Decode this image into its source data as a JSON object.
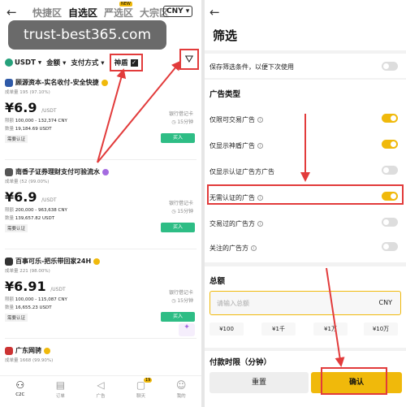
{
  "left": {
    "back_icon": "arrow-left-icon",
    "tabs": [
      {
        "label": "快捷区"
      },
      {
        "label": "自选区"
      },
      {
        "label": "严选区"
      },
      {
        "label": "大宗区"
      }
    ],
    "tab_badge": "NEW",
    "currency_select": "CNY ▾",
    "watermark": "trust-best365.com",
    "filters": {
      "coin": "USDT ▾",
      "amount": "金额 ▾",
      "payment": "支付方式 ▾",
      "shendun": "神盾"
    },
    "ads": [
      {
        "name": "顾源资本-实名收付-安全快捷",
        "stats": "成单量 195 (97.10%)",
        "price": "¥6.9",
        "unit": "/USDT",
        "limit_label": "限额",
        "limit": "100,000 - 132,374 CNY",
        "qty_label": "数量",
        "qty": "19,184.69 USDT",
        "pay": "银行借记卡",
        "time": "15分钟",
        "buy": "买入",
        "auth": "需要认证"
      },
      {
        "name": "南香子证券理财支付可验流水",
        "stats": "成单量 (52 (99.00%)",
        "price": "¥6.9",
        "unit": "/USDT",
        "limit_label": "限额",
        "limit": "200,000 - 963,638 CNY",
        "qty_label": "数量",
        "qty": "139,657.82 USDT",
        "pay": "银行借记卡",
        "time": "15分钟",
        "buy": "买入",
        "auth": "需要认证"
      },
      {
        "name": "百事可乐-把乐带回家24H",
        "stats": "成单量 221 (98.00%)",
        "price": "¥6.91",
        "unit": "/USDT",
        "limit_label": "限额",
        "limit": "100,000 - 115,087 CNY",
        "qty_label": "数量",
        "qty": "16,655.23 USDT",
        "pay": "银行借记卡",
        "time": "15分钟",
        "buy": "买入",
        "auth": "需要认证"
      },
      {
        "name": "广东网骋",
        "stats": "成单量 1668 (99.90%)",
        "price": "",
        "unit": "",
        "limit_label": "",
        "limit": "",
        "qty_label": "",
        "qty": "",
        "pay": "",
        "time": "",
        "buy": "",
        "auth": ""
      }
    ],
    "nav": [
      {
        "label": "C2C",
        "icon": "people-icon"
      },
      {
        "label": "订单",
        "icon": "orders-icon"
      },
      {
        "label": "广告",
        "icon": "megaphone-icon"
      },
      {
        "label": "聊天",
        "icon": "chat-icon"
      },
      {
        "label": "我的",
        "icon": "user-icon"
      }
    ],
    "chat_badge": "19"
  },
  "right": {
    "back_icon": "arrow-left-icon",
    "title": "筛选",
    "save_filter": "保存筛选条件，以便下次使用",
    "ad_type_heading": "广告类型",
    "options": [
      {
        "label": "仅限可交易广告",
        "on": true
      },
      {
        "label": "仅显示神盾广告",
        "on": true
      },
      {
        "label": "仅显示认证广告方广告",
        "on": false
      },
      {
        "label": "无需认证的广告",
        "on": true
      },
      {
        "label": "交易过的广告方",
        "on": false
      },
      {
        "label": "关注的广告方",
        "on": false
      }
    ],
    "amount_heading": "总额",
    "amount_placeholder": "请输入总额",
    "amount_currency": "CNY",
    "quick_amounts": [
      "¥100",
      "¥1千",
      "¥1万",
      "¥10万"
    ],
    "pay_time_heading": "付款时限（分钟）",
    "reset": "重置",
    "confirm": "确认"
  },
  "colors": {
    "accent": "#f0b90b",
    "buy": "#2ebd85",
    "highlight": "#e23b3b"
  }
}
